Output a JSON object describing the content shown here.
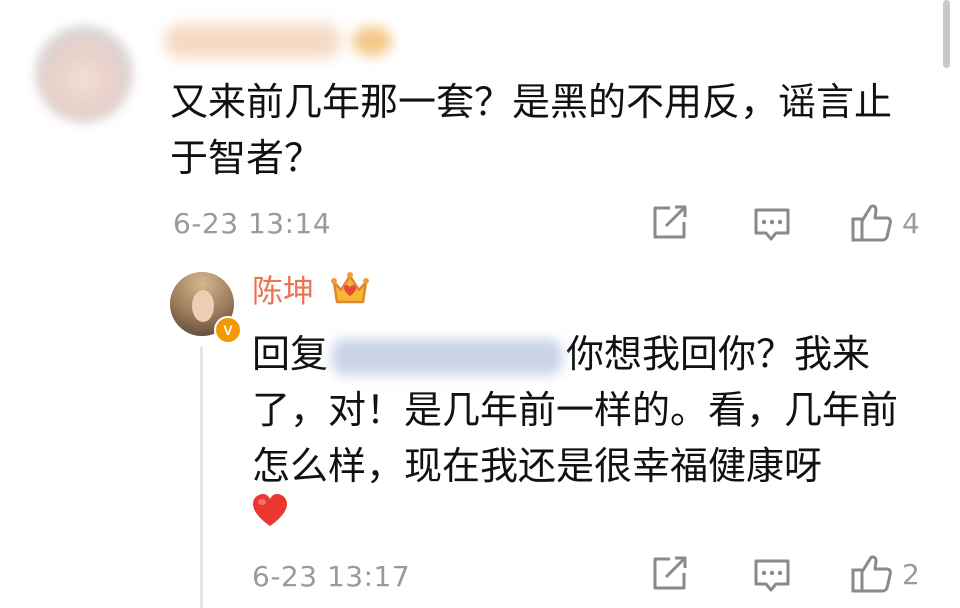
{
  "comment": {
    "text": "又来前几年那一套？是黑的不用反，谣言止于智者？",
    "time": "6-23 13:14",
    "likes": "4"
  },
  "reply": {
    "username": "陈坤",
    "prefix": "回复",
    "text": "你想我回你？我来了，对！是几年前一样的。看，几年前怎么样，现在我还是很幸福健康呀",
    "time": "6-23 13:17",
    "likes": "2"
  },
  "icons": {
    "share": "share-icon",
    "comment": "comment-icon",
    "like": "thumbs-up-icon",
    "heart": "heart-emoji-icon",
    "crown": "crown-badge-icon",
    "verified": "verified-v-icon"
  },
  "colors": {
    "username": "#eb7350",
    "meta": "#9a9a9a",
    "heart": "#e8382f",
    "verified": "#f39800"
  }
}
